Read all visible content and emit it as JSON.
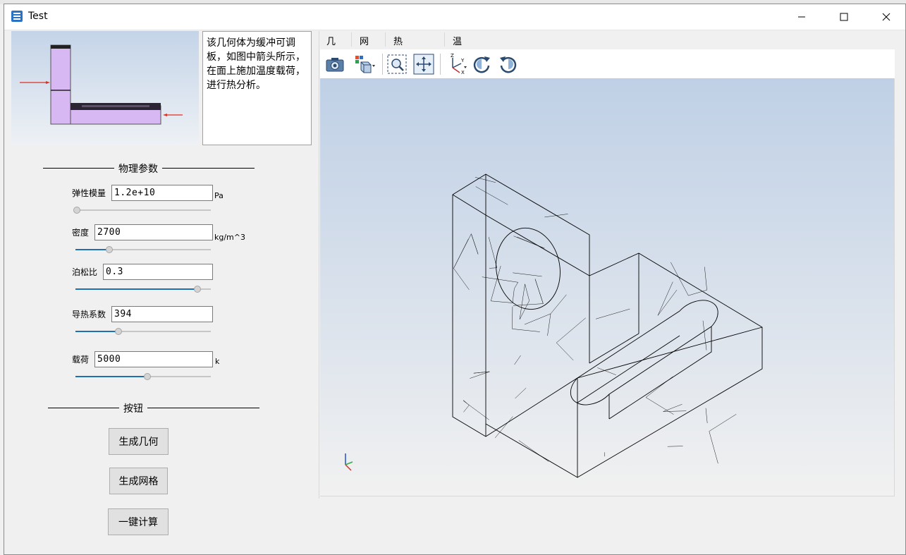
{
  "window": {
    "title": "Test"
  },
  "description": {
    "text": "该几何体为缓冲可调板，如图中箭头所示，在面上施加温度载荷，进行热分析。"
  },
  "params": {
    "group_title": "物理参数",
    "elastic_modulus": {
      "label": "弹性模量",
      "value": "1.2e+10",
      "unit": "Pa"
    },
    "density": {
      "label": "密度",
      "value": "2700",
      "unit": "kg/m^3",
      "slider": 0.25
    },
    "poisson": {
      "label": "泊松比",
      "value": "0.3",
      "slider": 0.9
    },
    "conductivity": {
      "label": "导热系数",
      "value": "394",
      "slider": 0.32
    },
    "load": {
      "label": "载荷",
      "value": "5000",
      "unit": "k",
      "slider": 0.53
    }
  },
  "buttons": {
    "group_title": "按钮",
    "gen_geometry": "生成几何",
    "gen_mesh": "生成网格",
    "compute": "一键计算"
  },
  "tabs": [
    "几何",
    "网格",
    "热通量云图",
    "温度等值线"
  ],
  "toolbar": [
    "camera-icon",
    "display-mode-icon",
    "zoom-box-icon",
    "fit-all-icon",
    "axis-orient-icon",
    "rotate-cw-icon",
    "rotate-ccw-icon"
  ],
  "colors": {
    "slider_fill": "#1f6fb2",
    "part_fill": "#d8b8f2"
  }
}
